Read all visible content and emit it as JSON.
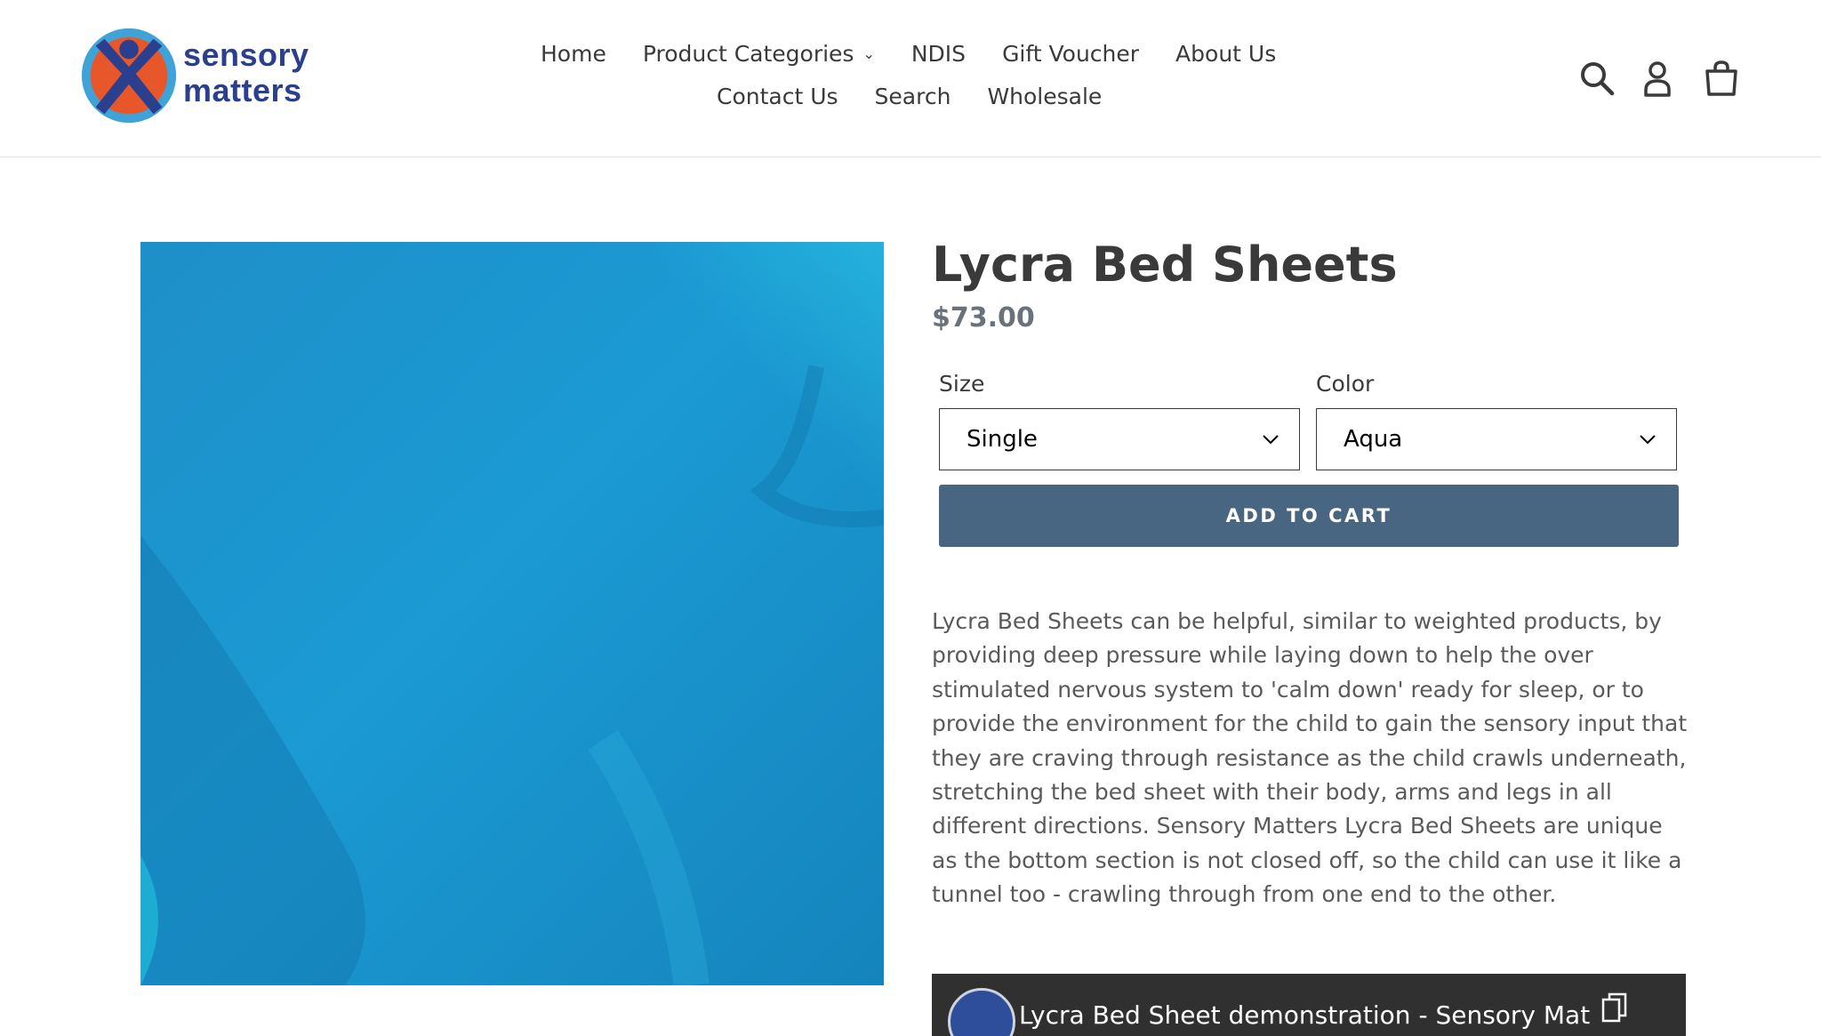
{
  "header": {
    "logo": {
      "line1": "sensory",
      "line2": "matters"
    },
    "nav_row1": [
      {
        "label": "Home",
        "name": "nav-home"
      },
      {
        "label": "Product Categories",
        "name": "nav-product-categories",
        "dropdown": true
      },
      {
        "label": "NDIS",
        "name": "nav-ndis"
      },
      {
        "label": "Gift Voucher",
        "name": "nav-gift-voucher"
      },
      {
        "label": "About Us",
        "name": "nav-about-us"
      }
    ],
    "nav_row2": [
      {
        "label": "Contact Us",
        "name": "nav-contact-us"
      },
      {
        "label": "Search",
        "name": "nav-search"
      },
      {
        "label": "Wholesale",
        "name": "nav-wholesale"
      }
    ],
    "icons": [
      "search-icon",
      "account-icon",
      "cart-icon"
    ]
  },
  "product": {
    "title": "Lycra Bed Sheets",
    "price": "$73.00",
    "size": {
      "label": "Size",
      "value": "Single"
    },
    "color": {
      "label": "Color",
      "value": "Aqua"
    },
    "add_to_cart": "ADD TO CART",
    "description": "Lycra Bed Sheets can be helpful, similar to weighted products, by providing deep pressure while laying down to help the over stimulated nervous system to 'calm down' ready for sleep, or to provide the environment for the child to gain the sensory input that they are craving through resistance as the child crawls underneath, stretching the bed sheet with their body, arms and legs in all different directions.  Sensory Matters Lycra Bed Sheets are unique as the bottom section is not closed off, so the child can use it like a tunnel too - crawling through from one end to the other."
  },
  "video": {
    "title": "Lycra Bed Sheet demonstration - Sensory Mat"
  },
  "colors": {
    "accent_button": "#486682",
    "brand_blue": "#2b3f8f",
    "brand_orange": "#e8572a",
    "fabric": "#1a9cd0",
    "text": "#3a3a3a",
    "price": "#69727b"
  }
}
